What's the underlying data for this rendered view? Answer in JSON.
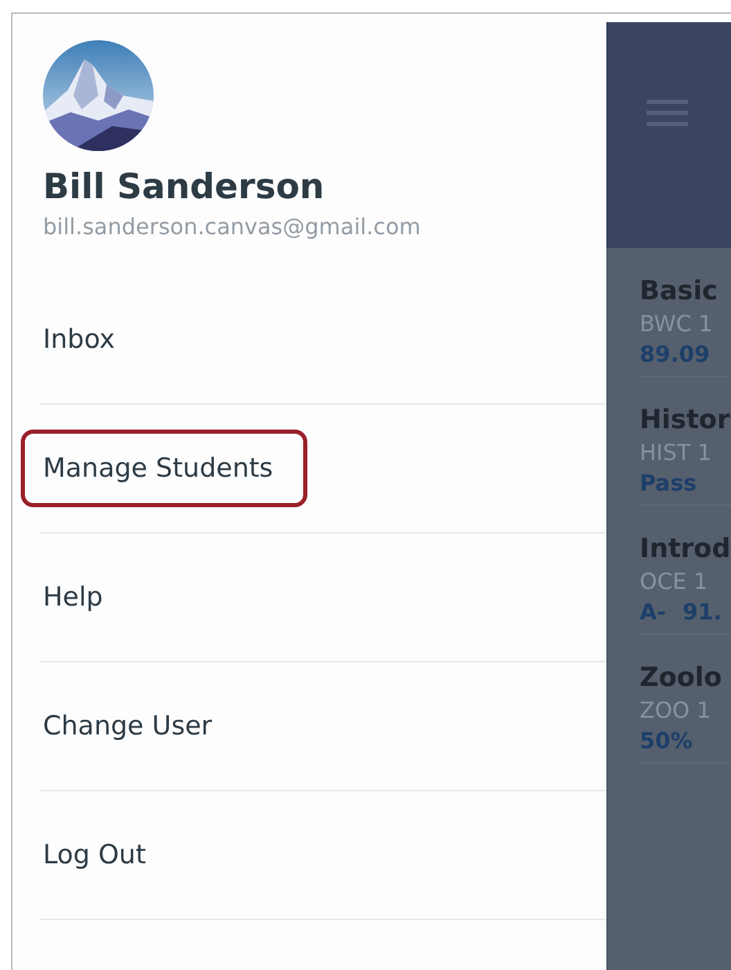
{
  "profile": {
    "name": "Bill Sanderson",
    "email": "bill.sanderson.canvas@gmail.com"
  },
  "menu": [
    {
      "label": "Inbox",
      "highlighted": false
    },
    {
      "label": "Manage Students",
      "highlighted": true
    },
    {
      "label": "Help",
      "highlighted": false
    },
    {
      "label": "Change User",
      "highlighted": false
    },
    {
      "label": "Log Out",
      "highlighted": false
    }
  ],
  "courses": [
    {
      "title": "Basic",
      "code": "BWC 1",
      "grades": [
        "89.09"
      ]
    },
    {
      "title": "Histor",
      "code": "HIST 1",
      "grades": [
        "Pass"
      ]
    },
    {
      "title": "Introd",
      "code": "OCE 1",
      "grades": [
        "A-",
        "91."
      ]
    },
    {
      "title": "Zoolo",
      "code": "ZOO 1",
      "grades": [
        "50%"
      ]
    }
  ]
}
